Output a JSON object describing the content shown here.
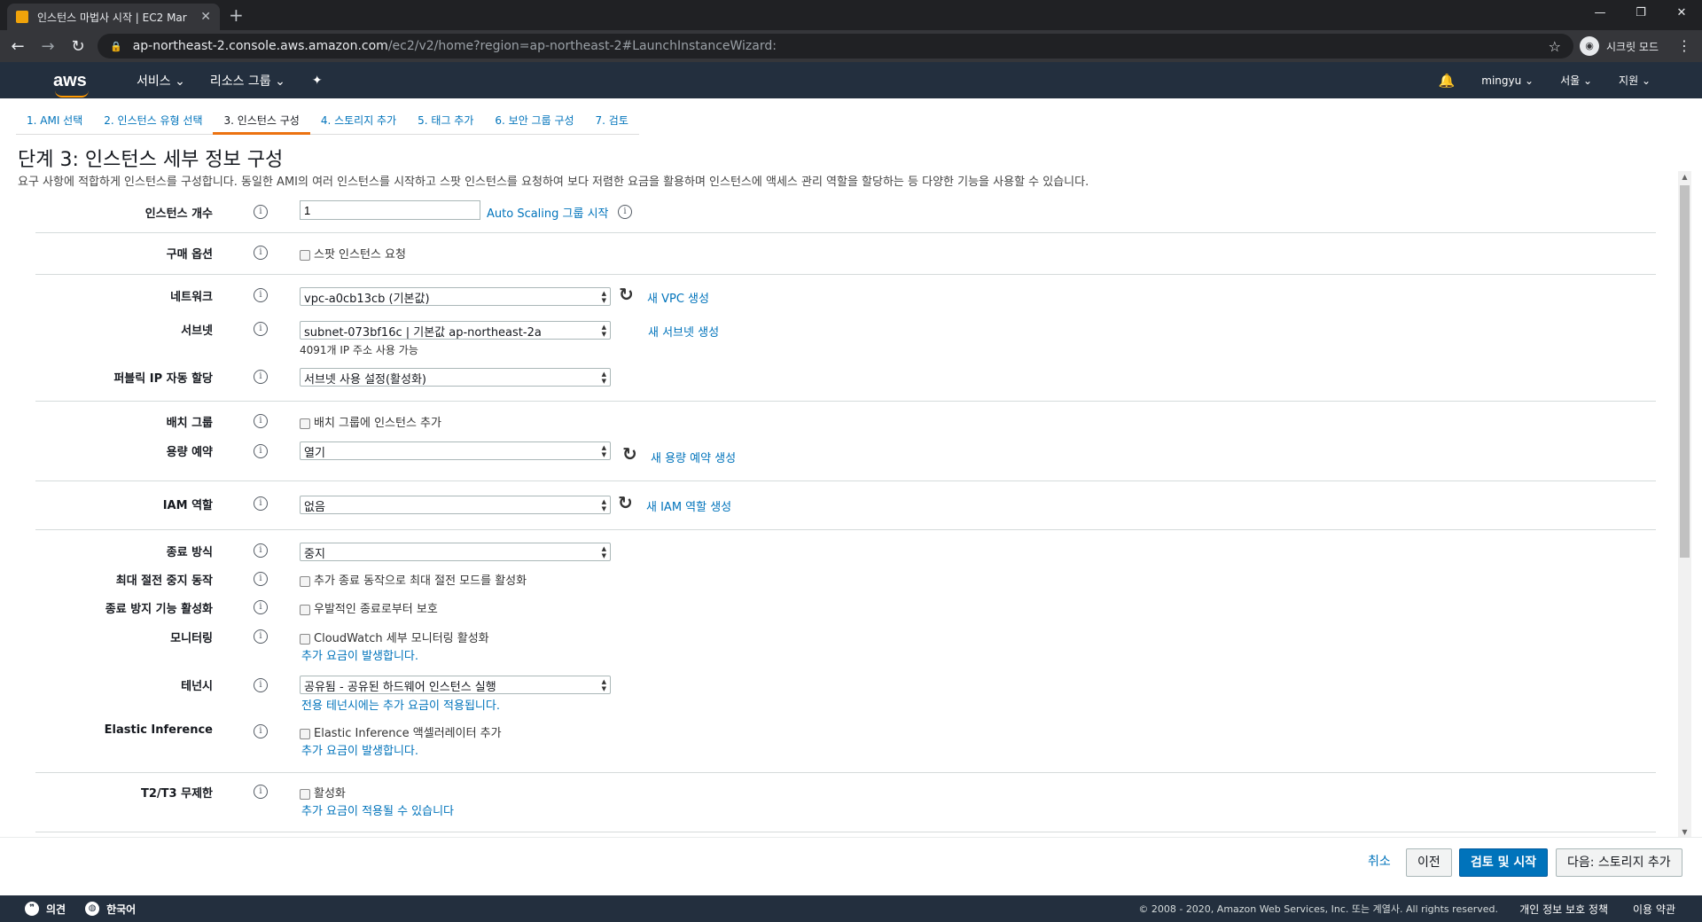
{
  "browser": {
    "tab_title": "인스턴스 마법사 시작 | EC2 Mar",
    "new_tab": "+",
    "url_host": "ap-northeast-2.console.aws.amazon.com",
    "url_path": "/ec2/v2/home?region=ap-northeast-2#LaunchInstanceWizard:",
    "incognito_label": "시크릿 모드"
  },
  "aws_nav": {
    "logo": "aws",
    "services": "서비스 ⌄",
    "resource_groups": "리소스 그룹 ⌄",
    "user": "mingyu ⌄",
    "region": "서울 ⌄",
    "support": "지원 ⌄"
  },
  "wizard_tabs": [
    {
      "label": "1. AMI 선택"
    },
    {
      "label": "2. 인스턴스 유형 선택"
    },
    {
      "label": "3. 인스턴스 구성"
    },
    {
      "label": "4. 스토리지 추가"
    },
    {
      "label": "5. 태그 추가"
    },
    {
      "label": "6. 보안 그룹 구성"
    },
    {
      "label": "7. 검토"
    }
  ],
  "page": {
    "title": "단계 3: 인스턴스 세부 정보 구성",
    "description": "요구 사항에 적합하게 인스턴스를 구성합니다. 동일한 AMI의 여러 인스턴스를 시작하고 스팟 인스턴스를 요청하여 보다 저렴한 요금을 활용하며 인스턴스에 액세스 관리 역할을 할당하는 등 다양한 기능을 사용할 수 있습니다."
  },
  "form": {
    "instance_count": {
      "label": "인스턴스 개수",
      "value": "1",
      "link": "Auto Scaling 그룹 시작"
    },
    "purchase": {
      "label": "구매 옵션",
      "checkbox": "스팟 인스턴스 요청"
    },
    "network": {
      "label": "네트워크",
      "value": "vpc-a0cb13cb (기본값)",
      "link": "새 VPC 생성"
    },
    "subnet": {
      "label": "서브넷",
      "value": "subnet-073bf16c | 기본값 ap-northeast-2a",
      "note": "4091개 IP 주소 사용 가능",
      "link": "새 서브넷 생성"
    },
    "public_ip": {
      "label": "퍼블릭 IP 자동 할당",
      "value": "서브넷 사용 설정(활성화)"
    },
    "placement": {
      "label": "배치 그룹",
      "checkbox": "배치 그룹에 인스턴스 추가"
    },
    "capacity": {
      "label": "용량 예약",
      "value": "열기",
      "link": "새 용량 예약 생성"
    },
    "iam": {
      "label": "IAM 역할",
      "value": "없음",
      "link": "새 IAM 역할 생성"
    },
    "shutdown": {
      "label": "종료 방식",
      "value": "중지"
    },
    "hibernate": {
      "label": "최대 절전 중지 동작",
      "checkbox": "추가 종료 동작으로 최대 절전 모드를 활성화"
    },
    "termination": {
      "label": "종료 방지 기능 활성화",
      "checkbox": "우발적인 종료로부터 보호"
    },
    "monitoring": {
      "label": "모니터링",
      "checkbox": "CloudWatch 세부 모니터링 활성화",
      "note": "추가 요금이 발생합니다."
    },
    "tenancy": {
      "label": "테넌시",
      "value": "공유됨 - 공유된 하드웨어 인스턴스 실행",
      "note": "전용 테넌시에는 추가 요금이 적용됩니다."
    },
    "elastic": {
      "label": "Elastic Inference",
      "checkbox": "Elastic Inference 액셀러레이터 추가",
      "note": "추가 요금이 발생합니다."
    },
    "t2t3": {
      "label": "T2/T3 무제한",
      "checkbox": "활성화",
      "note": "추가 요금이 적용될 수 있습니다"
    }
  },
  "actions": {
    "cancel": "취소",
    "previous": "이전",
    "review": "검토 및 시작",
    "next": "다음: 스토리지 추가"
  },
  "footer": {
    "feedback": "의견",
    "language": "한국어",
    "copyright": "© 2008 - 2020, Amazon Web Services, Inc. 또는 계열사. All rights reserved.",
    "privacy": "개인 정보 보호 정책",
    "terms": "이용 약관"
  }
}
